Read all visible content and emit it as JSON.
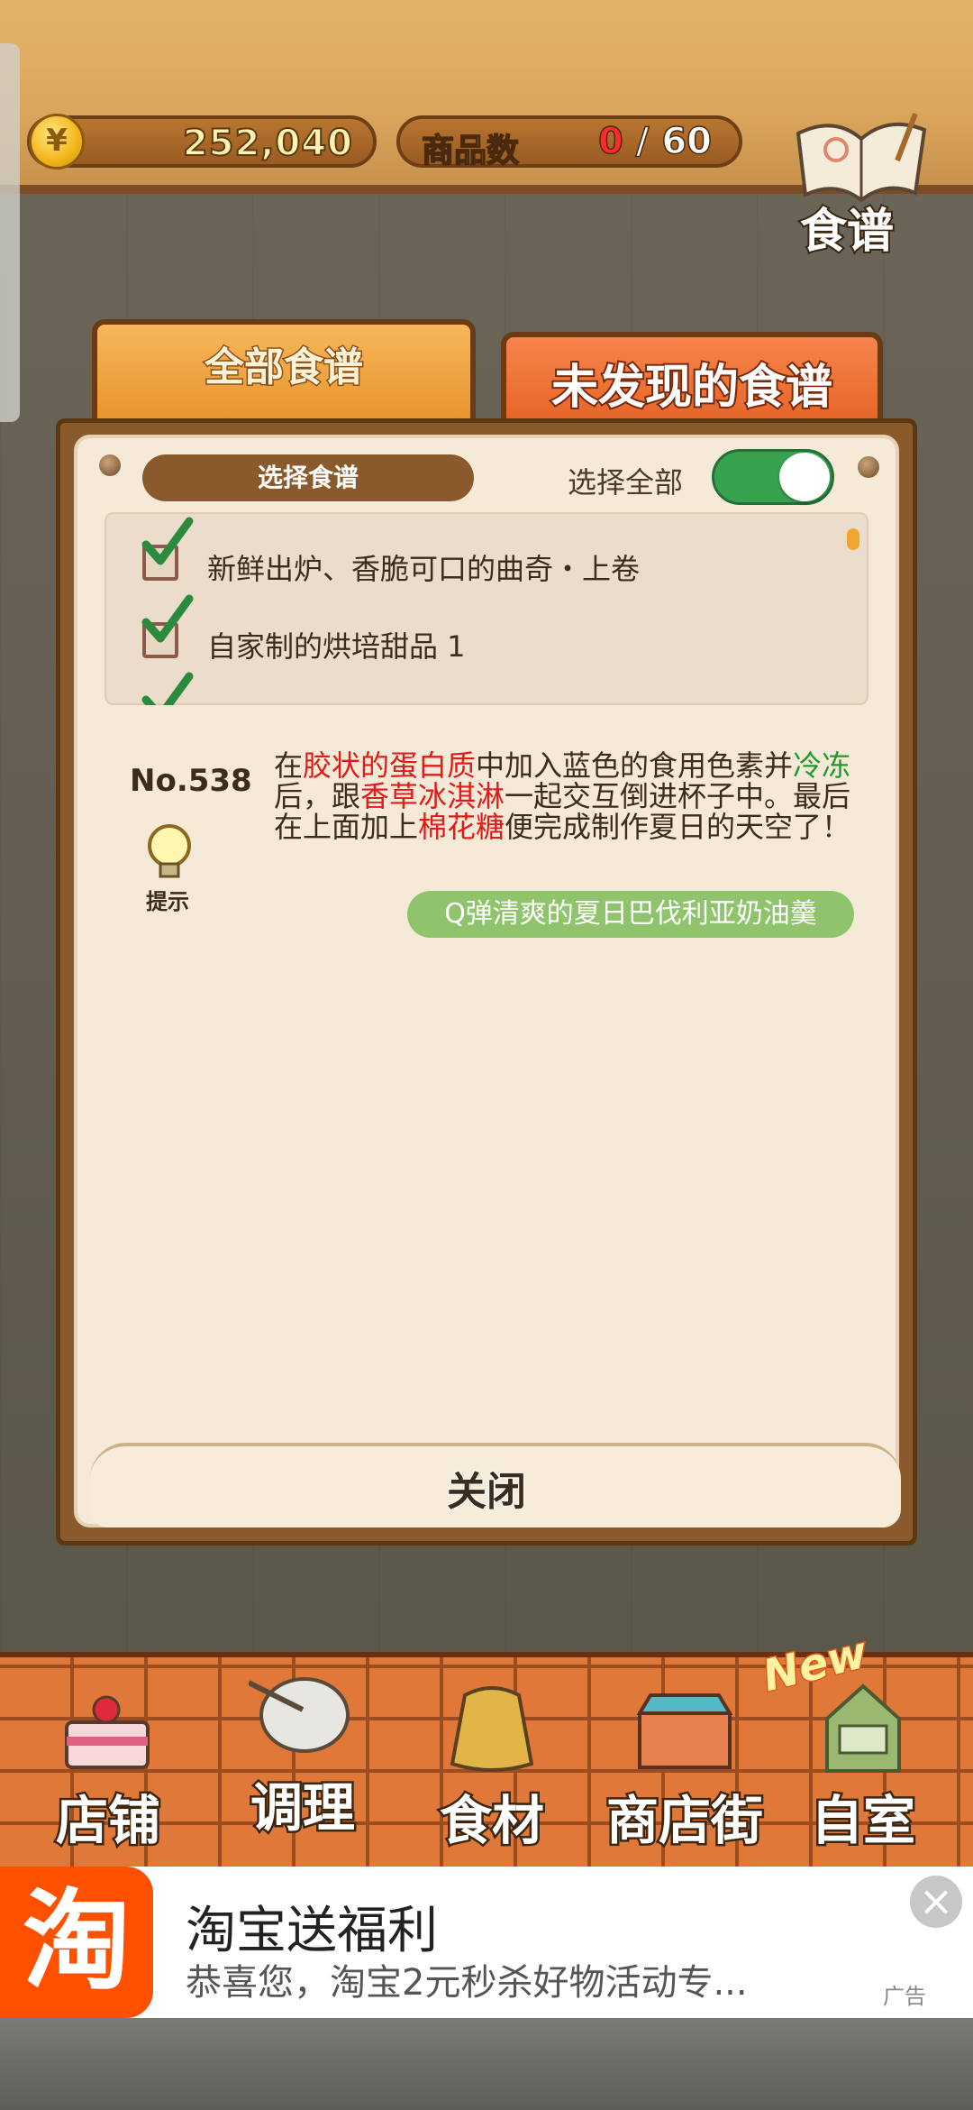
{
  "header": {
    "coins": "252,040",
    "goods_label": "商品数",
    "goods_current": "0",
    "goods_max": "/ 60",
    "recipe_book_label": "食谱"
  },
  "tabs": [
    {
      "label": "全部食谱",
      "active": false
    },
    {
      "label": "未发现的食谱",
      "active": true
    }
  ],
  "panel": {
    "select_recipe_label": "选择食谱",
    "select_all_label": "选择全部",
    "select_all_on": true,
    "recipes": [
      {
        "label": "新鲜出炉、香脆可口的曲奇・上卷",
        "checked": true
      },
      {
        "label": "自家制的烘培甜品 1",
        "checked": true
      }
    ],
    "recipe_number": "No.538",
    "hint_label": "提示",
    "description_parts": [
      {
        "text": "在",
        "color": "normal"
      },
      {
        "text": "胶状的蛋白质",
        "color": "red"
      },
      {
        "text": "中加入蓝色的食用色素并",
        "color": "normal"
      },
      {
        "text": "冷冻",
        "color": "green"
      },
      {
        "text": "后，跟",
        "color": "normal"
      },
      {
        "text": "香草冰淇淋",
        "color": "red"
      },
      {
        "text": "一起交互倒进杯子中。最后在上面加上",
        "color": "normal"
      },
      {
        "text": "棉花糖",
        "color": "red"
      },
      {
        "text": "便完成制作夏日的天空了！",
        "color": "normal"
      }
    ],
    "result_name": "Q弹清爽的夏日巴伐利亚奶油羹",
    "close_label": "关闭"
  },
  "nav": {
    "items": [
      {
        "label": "店铺",
        "icon": "cake-icon"
      },
      {
        "label": "调理",
        "icon": "bowl-icon"
      },
      {
        "label": "食材",
        "icon": "sack-icon"
      },
      {
        "label": "商店街",
        "icon": "shop-icon"
      },
      {
        "label": "自室",
        "icon": "staff-door-icon"
      }
    ],
    "new_badge": "New"
  },
  "ad": {
    "logo_text": "淘",
    "title": "淘宝送福利",
    "subtitle": "恭喜您，淘宝2元秒杀好物活动专...",
    "tag": "广告"
  },
  "colors": {
    "accent_orange": "#e25f22",
    "toggle_green": "#39a24f",
    "result_green": "#8fc46d",
    "highlight_red": "#e11a1a",
    "highlight_green": "#1f9a2e",
    "taobao_orange": "#ff5000"
  }
}
